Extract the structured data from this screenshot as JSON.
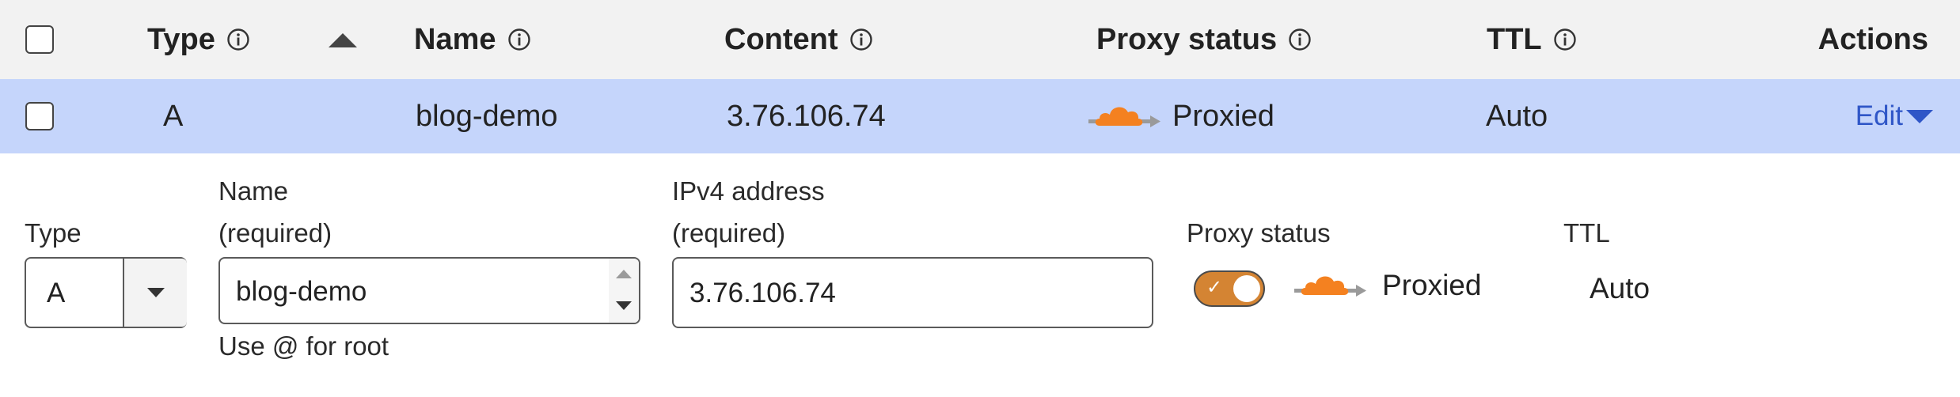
{
  "table": {
    "headers": {
      "type": "Type",
      "name": "Name",
      "content": "Content",
      "proxy_status": "Proxy status",
      "ttl": "TTL",
      "actions": "Actions"
    },
    "row": {
      "type": "A",
      "name": "blog-demo",
      "content": "3.76.106.74",
      "proxy_status": "Proxied",
      "ttl": "Auto",
      "edit_label": "Edit"
    }
  },
  "editor": {
    "type_label": "Type",
    "type_value": "A",
    "name_label": "Name",
    "name_required": "(required)",
    "name_value": "blog-demo",
    "name_hint": "Use @ for root",
    "address_label": "IPv4 address",
    "address_required": "(required)",
    "address_value": "3.76.106.74",
    "proxy_label": "Proxy status",
    "proxy_value": "Proxied",
    "proxy_enabled": true,
    "ttl_label": "TTL",
    "ttl_value": "Auto"
  },
  "colors": {
    "row_highlight": "#c5d5fb",
    "header_bg": "#f2f2f2",
    "cloud_orange": "#f48120",
    "toggle_on": "#d48433",
    "link_blue": "#2f56c7"
  }
}
